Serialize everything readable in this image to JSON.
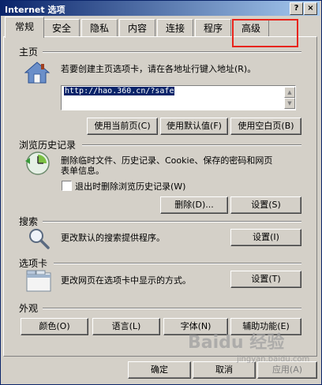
{
  "window": {
    "title": "Internet 选项",
    "help_label": "?",
    "close_label": "×"
  },
  "tabs": [
    {
      "label": "常规",
      "active": true
    },
    {
      "label": "安全"
    },
    {
      "label": "隐私"
    },
    {
      "label": "内容"
    },
    {
      "label": "连接"
    },
    {
      "label": "程序"
    },
    {
      "label": "高级"
    }
  ],
  "homepage": {
    "section_label": "主页",
    "description": "若要创建主页选项卡，请在各地址行键入地址(R)。",
    "url": "http://hao.360.cn/?safe",
    "use_current": "使用当前页(C)",
    "use_default": "使用默认值(F)",
    "use_blank": "使用空白页(B)"
  },
  "history": {
    "section_label": "浏览历史记录",
    "description_line1": "删除临时文件、历史记录、Cookie、保存的密码和网页",
    "description_line2": "表单信息。",
    "checkbox_label": "退出时删除浏览历史记录(W)",
    "checkbox_checked": false,
    "delete_button": "删除(D)...",
    "settings_button": "设置(S)"
  },
  "search": {
    "section_label": "搜索",
    "description": "更改默认的搜索提供程序。",
    "settings_button": "设置(I)"
  },
  "tabs_section": {
    "section_label": "选项卡",
    "description": "更改网页在选项卡中显示的方式。",
    "settings_button": "设置(T)"
  },
  "appearance": {
    "section_label": "外观",
    "colors_button": "颜色(O)",
    "languages_button": "语言(L)",
    "fonts_button": "字体(N)",
    "accessibility_button": "辅助功能(E)"
  },
  "footer": {
    "ok_button": "确定",
    "cancel_button": "取消",
    "apply_button": "应用(A)"
  },
  "watermark": {
    "brand": "Baidu 经验",
    "url": "jingyan.baidu.com"
  },
  "colors": {
    "highlight_border": "#e8241c",
    "title_gradient_start": "#0a246a",
    "title_gradient_end": "#a6caf0",
    "face": "#d4d0c8"
  }
}
